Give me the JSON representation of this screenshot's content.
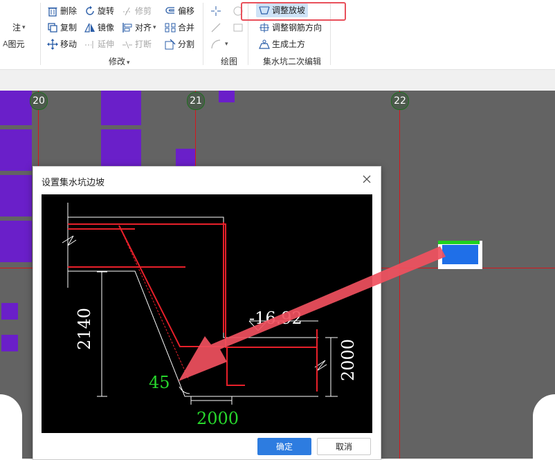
{
  "ribbon": {
    "left_partial": [
      "注",
      "图元"
    ],
    "modify": {
      "delete": "删除",
      "rotate": "旋转",
      "trim": "修剪",
      "offset": "偏移",
      "copy": "复制",
      "mirror": "镜像",
      "align": "对齐",
      "merge": "合并",
      "move": "移动",
      "extend": "延伸",
      "break": "打断",
      "split": "分割",
      "label": "修改"
    },
    "draw": {
      "label": "绘图"
    },
    "pit_edit": {
      "adjust_slope": "调整放坡",
      "adjust_rebar_direction": "调整钢筋方向",
      "generate_earthwork": "生成土方",
      "label": "集水坑二次编辑"
    }
  },
  "canvas": {
    "axis_labels": [
      "20",
      "21",
      "22"
    ],
    "colors": {
      "background": "#636363",
      "grid_line": "#d8161b",
      "block": "#6a1fc9",
      "pit": "#1f6fe8"
    }
  },
  "dialog": {
    "title": "设置集水坑边坡",
    "diagram": {
      "depth_label": "2140",
      "elevation_label": "-16.92",
      "right_dim_label": "2000",
      "angle_label": "45",
      "bottom_dim_label": "2000"
    },
    "ok_label": "确定",
    "cancel_label": "取消"
  }
}
